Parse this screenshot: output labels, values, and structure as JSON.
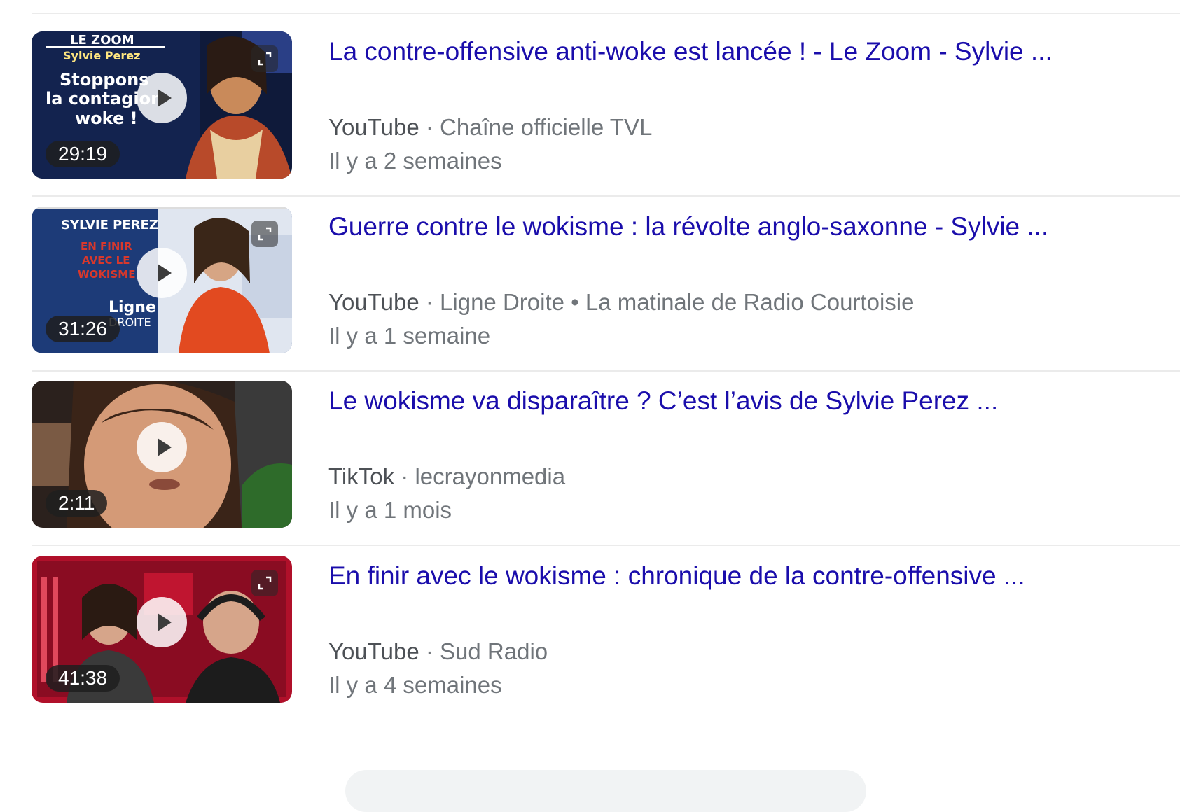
{
  "results": [
    {
      "title": "La contre-offensive anti-woke est lancée ! - Le Zoom - Sylvie ...",
      "source": "YouTube",
      "channel": "Chaîne officielle TVL",
      "time": "Il y a 2 semaines",
      "duration": "29:19",
      "thumb": {
        "overlay_lines": [
          "LE ZOOM",
          "Sylvie Perez",
          "Stoppons",
          "la contagion",
          "woke !"
        ],
        "colors": {
          "bg": "#0f1a3a",
          "accent": "#2a3f86",
          "person": "#c98a5a",
          "scarf": "#b84a2a"
        }
      }
    },
    {
      "title": "Guerre contre le wokisme : la révolte anglo-saxonne - Sylvie ...",
      "source": "YouTube",
      "channel": "Ligne Droite • La matinale de Radio Courtoisie",
      "time": "Il y a 1 semaine",
      "duration": "31:26",
      "thumb": {
        "overlay_lines": [
          "SYLVIE PEREZ",
          "EN FINIR",
          "AVEC LE",
          "WOKISME",
          "Ligne",
          "DROITE"
        ],
        "colors": {
          "bg": "#1d3b78",
          "accent": "#e0e6f0",
          "person": "#e24a20",
          "text_red": "#d8382c"
        }
      }
    },
    {
      "title": "Le wokisme va disparaître ? C’est l’avis de Sylvie Perez ...",
      "source": "TikTok",
      "channel": "lecrayonmedia",
      "time": "Il y a 1 mois",
      "duration": "2:11",
      "thumb": {
        "overlay_lines": [],
        "colors": {
          "bg": "#2b211d",
          "accent": "#5a3d2f",
          "person": "#d49a77",
          "plant": "#2e6b2a"
        }
      }
    },
    {
      "title": "En finir avec le wokisme : chronique de la contre-offensive ...",
      "source": "YouTube",
      "channel": "Sud Radio",
      "time": "Il y a 4 semaines",
      "duration": "41:38",
      "thumb": {
        "overlay_lines": [],
        "colors": {
          "bg": "#b0102a",
          "accent": "#e0485c",
          "person": "#d6a58a",
          "dark": "#1c1c1c"
        }
      }
    }
  ],
  "icons": {
    "play": "play-icon",
    "expand": "expand-icon"
  },
  "link_color": "#1a0dab"
}
